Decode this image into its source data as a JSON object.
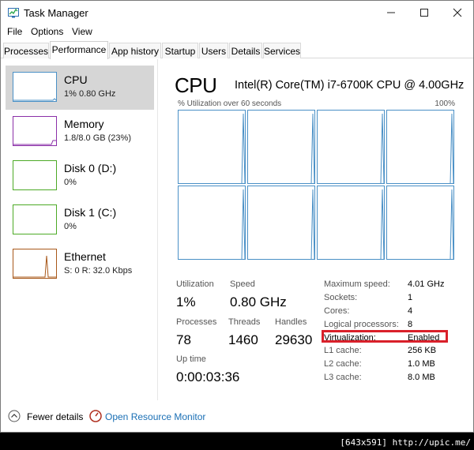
{
  "window": {
    "title": "Task Manager"
  },
  "menu": [
    "File",
    "Options",
    "View"
  ],
  "tabs": [
    "Processes",
    "Performance",
    "App history",
    "Startup",
    "Users",
    "Details",
    "Services"
  ],
  "active_tab": "Performance",
  "sidebar": [
    {
      "name": "CPU",
      "sub": "1% 0.80 GHz",
      "color": "#4a90c6"
    },
    {
      "name": "Memory",
      "sub": "1.8/8.0 GB (23%)",
      "color": "#8b2fa8"
    },
    {
      "name": "Disk 0 (D:)",
      "sub": "0%",
      "color": "#4caa26"
    },
    {
      "name": "Disk 1 (C:)",
      "sub": "0%",
      "color": "#4caa26"
    },
    {
      "name": "Ethernet",
      "sub": "S: 0 R: 32.0 Kbps",
      "color": "#a8581a"
    }
  ],
  "main": {
    "title": "CPU",
    "cpu_name": "Intel(R) Core(TM) i7-6700K CPU @ 4.00GHz",
    "graph_label": "% Utilization over 60 seconds",
    "graph_max": "100%",
    "stats": {
      "utilization_label": "Utilization",
      "utilization": "1%",
      "speed_label": "Speed",
      "speed": "0.80 GHz",
      "processes_label": "Processes",
      "processes": "78",
      "threads_label": "Threads",
      "threads": "1460",
      "handles_label": "Handles",
      "handles": "29630",
      "uptime_label": "Up time",
      "uptime": "0:00:03:36"
    },
    "details": [
      {
        "label": "Maximum speed:",
        "value": "4.01 GHz"
      },
      {
        "label": "Sockets:",
        "value": "1"
      },
      {
        "label": "Cores:",
        "value": "4"
      },
      {
        "label": "Logical processors:",
        "value": "8"
      },
      {
        "label": "Virtualization:",
        "value": "Enabled"
      },
      {
        "label": "L1 cache:",
        "value": "256 KB"
      },
      {
        "label": "L2 cache:",
        "value": "1.0 MB"
      },
      {
        "label": "L3 cache:",
        "value": "8.0 MB"
      }
    ]
  },
  "footer": {
    "fewer_details": "Fewer details",
    "open_monitor": "Open Resource Monitor"
  },
  "caption": "[643x591] http://upic.me/",
  "colors": {
    "cpu": "#4a90c6",
    "highlight": "#d9202a",
    "link": "#1a6fb5"
  }
}
